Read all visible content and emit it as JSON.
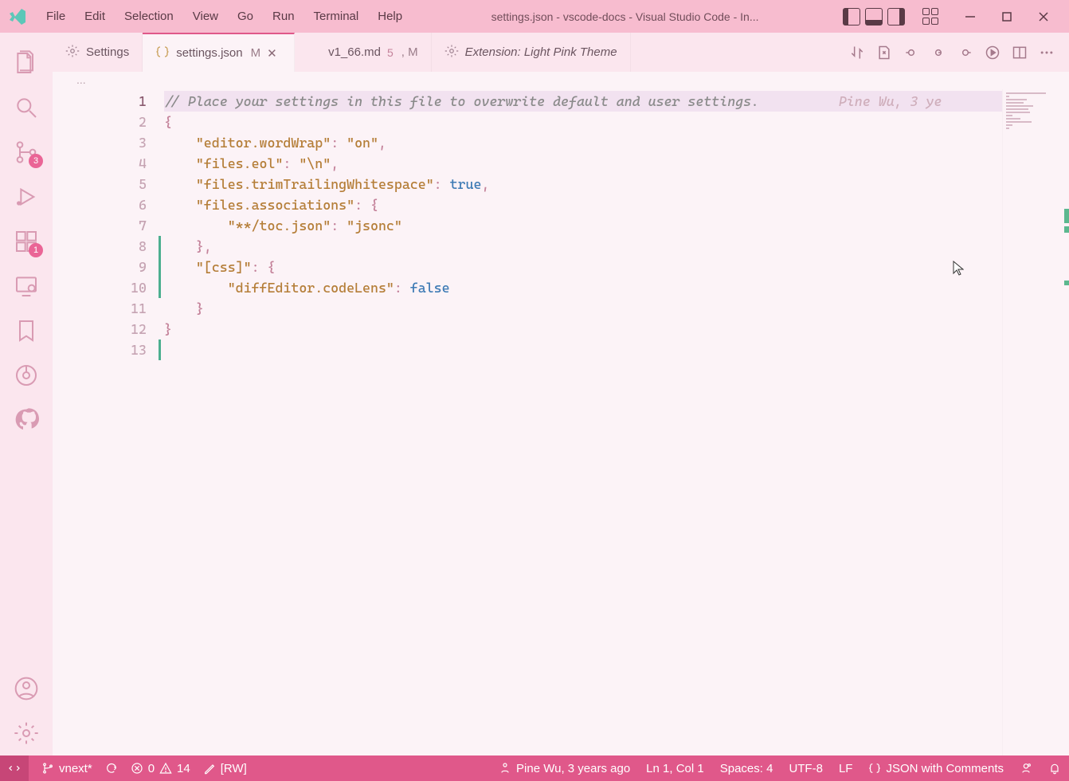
{
  "titlebar": {
    "menus": [
      "File",
      "Edit",
      "Selection",
      "View",
      "Go",
      "Run",
      "Terminal",
      "Help"
    ],
    "title": "settings.json - vscode-docs - Visual Studio Code - In..."
  },
  "activitybar": {
    "scm_badge": "3",
    "ext_badge": "1"
  },
  "tabs": [
    {
      "icon": "settings",
      "name": "Settings",
      "active": false,
      "mod": "",
      "badge": "",
      "preview": false,
      "closable": false
    },
    {
      "icon": "json",
      "name": "settings.json",
      "active": true,
      "mod": "M",
      "badge": "",
      "preview": false,
      "closable": true
    },
    {
      "icon": "markdown",
      "name": "v1_66.md",
      "active": false,
      "mod": ", M",
      "badge": "5",
      "preview": false,
      "closable": false
    },
    {
      "icon": "settings",
      "name": "Extension: Light Pink Theme",
      "active": false,
      "mod": "",
      "badge": "",
      "preview": true,
      "closable": false
    }
  ],
  "breadcrumb": "...",
  "code": {
    "blame_inline": "Pine Wu, 3 ye",
    "lines": [
      {
        "n": 1,
        "hl": true,
        "tokens": [
          {
            "t": "// Place your settings in this file to overwrite default and user settings.",
            "c": "c-comment"
          }
        ]
      },
      {
        "n": 2,
        "tokens": [
          {
            "t": "{",
            "c": "c-brace"
          }
        ]
      },
      {
        "n": 3,
        "tokens": [
          {
            "t": "    ",
            "c": ""
          },
          {
            "t": "\"editor.wordWrap\"",
            "c": "c-key"
          },
          {
            "t": ": ",
            "c": "c-punc"
          },
          {
            "t": "\"on\"",
            "c": "c-string"
          },
          {
            "t": ",",
            "c": "c-punc"
          }
        ]
      },
      {
        "n": 4,
        "tokens": [
          {
            "t": "    ",
            "c": ""
          },
          {
            "t": "\"files.eol\"",
            "c": "c-key"
          },
          {
            "t": ": ",
            "c": "c-punc"
          },
          {
            "t": "\"\\n\"",
            "c": "c-string"
          },
          {
            "t": ",",
            "c": "c-punc"
          }
        ]
      },
      {
        "n": 5,
        "tokens": [
          {
            "t": "    ",
            "c": ""
          },
          {
            "t": "\"files.trimTrailingWhitespace\"",
            "c": "c-key"
          },
          {
            "t": ": ",
            "c": "c-punc"
          },
          {
            "t": "true",
            "c": "c-bool"
          },
          {
            "t": ",",
            "c": "c-punc"
          }
        ]
      },
      {
        "n": 6,
        "tokens": [
          {
            "t": "    ",
            "c": ""
          },
          {
            "t": "\"files.associations\"",
            "c": "c-key"
          },
          {
            "t": ": ",
            "c": "c-punc"
          },
          {
            "t": "{",
            "c": "c-brace"
          }
        ]
      },
      {
        "n": 7,
        "tokens": [
          {
            "t": "        ",
            "c": ""
          },
          {
            "t": "\"**/toc.json\"",
            "c": "c-key"
          },
          {
            "t": ": ",
            "c": "c-punc"
          },
          {
            "t": "\"jsonc\"",
            "c": "c-string"
          }
        ]
      },
      {
        "n": 8,
        "tokens": [
          {
            "t": "    ",
            "c": ""
          },
          {
            "t": "}",
            "c": "c-brace"
          },
          {
            "t": ",",
            "c": "c-punc"
          }
        ]
      },
      {
        "n": 9,
        "tokens": [
          {
            "t": "    ",
            "c": ""
          },
          {
            "t": "\"[css]\"",
            "c": "c-key"
          },
          {
            "t": ": ",
            "c": "c-punc"
          },
          {
            "t": "{",
            "c": "c-brace"
          }
        ]
      },
      {
        "n": 10,
        "tokens": [
          {
            "t": "        ",
            "c": ""
          },
          {
            "t": "\"diffEditor.codeLens\"",
            "c": "c-key"
          },
          {
            "t": ": ",
            "c": "c-punc"
          },
          {
            "t": "false",
            "c": "c-bool"
          }
        ]
      },
      {
        "n": 11,
        "tokens": [
          {
            "t": "    ",
            "c": ""
          },
          {
            "t": "}",
            "c": "c-brace"
          }
        ]
      },
      {
        "n": 12,
        "tokens": [
          {
            "t": "}",
            "c": "c-brace"
          }
        ]
      },
      {
        "n": 13,
        "tokens": [
          {
            "t": "",
            "c": ""
          }
        ]
      }
    ],
    "modified_ranges": [
      {
        "from": 8,
        "to": 10
      },
      {
        "from": 13,
        "to": 13
      }
    ]
  },
  "statusbar": {
    "branch": "vnext*",
    "errors": "0",
    "warnings": "14",
    "rw": "[RW]",
    "blame": "Pine Wu, 3 years ago",
    "pos": "Ln 1, Col 1",
    "spaces": "Spaces: 4",
    "encoding": "UTF-8",
    "eol": "LF",
    "lang": "JSON with Comments"
  }
}
